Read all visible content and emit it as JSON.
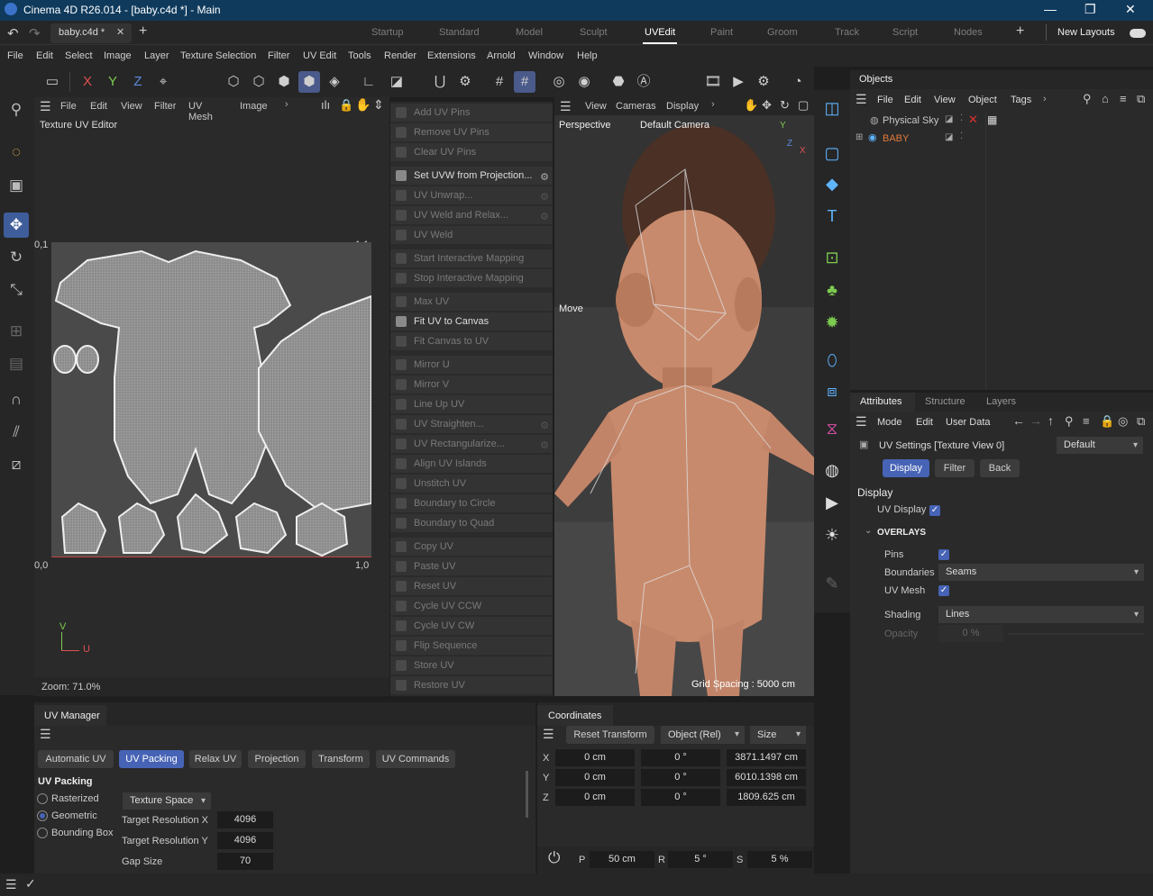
{
  "title": "Cinema 4D R26.014 - [baby.c4d *] - Main",
  "doc_tab": "baby.c4d *",
  "layouts": [
    {
      "label": "Startup",
      "active": false
    },
    {
      "label": "Standard",
      "active": false
    },
    {
      "label": "Model",
      "active": false
    },
    {
      "label": "Sculpt",
      "active": false
    },
    {
      "label": "UVEdit",
      "active": true
    },
    {
      "label": "Paint",
      "active": false
    },
    {
      "label": "Groom",
      "active": false
    },
    {
      "label": "Track",
      "active": false
    },
    {
      "label": "Script",
      "active": false
    },
    {
      "label": "Nodes",
      "active": false
    }
  ],
  "new_layouts": "New Layouts",
  "menu": [
    "File",
    "Edit",
    "Select",
    "Image",
    "Layer",
    "Texture Selection",
    "Filter",
    "UV Edit",
    "Tools",
    "Render",
    "Extensions",
    "Arnold",
    "Window",
    "Help"
  ],
  "uv_editor": {
    "submenu": [
      "File",
      "Edit",
      "View",
      "Filter",
      "UV Mesh",
      "Image"
    ],
    "title": "Texture UV Editor",
    "corners": {
      "tl": "0,1",
      "tr": "1,1",
      "bl": "0,0",
      "br": "1,0"
    },
    "axis_v": "V",
    "axis_u": "U",
    "zoom": "Zoom: 71.0%"
  },
  "commands": [
    {
      "label": "Add UV Pins",
      "enabled": false,
      "gear": false
    },
    {
      "label": "Remove UV Pins",
      "enabled": false,
      "gear": false
    },
    {
      "label": "Clear UV Pins",
      "enabled": false,
      "gear": false
    },
    {
      "label": "Set UVW from Projection...",
      "enabled": true,
      "gear": true
    },
    {
      "label": "UV Unwrap...",
      "enabled": false,
      "gear": true
    },
    {
      "label": "UV Weld and Relax...",
      "enabled": false,
      "gear": true
    },
    {
      "label": "UV Weld",
      "enabled": false,
      "gear": false
    },
    {
      "label": "Start Interactive Mapping",
      "enabled": false,
      "gear": false
    },
    {
      "label": "Stop Interactive Mapping",
      "enabled": false,
      "gear": false
    },
    {
      "label": "Max UV",
      "enabled": false,
      "gear": false
    },
    {
      "label": "Fit UV to Canvas",
      "enabled": true,
      "gear": false
    },
    {
      "label": "Fit Canvas to UV",
      "enabled": false,
      "gear": false
    },
    {
      "label": "Mirror U",
      "enabled": false,
      "gear": false
    },
    {
      "label": "Mirror V",
      "enabled": false,
      "gear": false
    },
    {
      "label": "Line Up UV",
      "enabled": false,
      "gear": false
    },
    {
      "label": "UV Straighten...",
      "enabled": false,
      "gear": true
    },
    {
      "label": "UV Rectangularize...",
      "enabled": false,
      "gear": true
    },
    {
      "label": "Align UV Islands",
      "enabled": false,
      "gear": false
    },
    {
      "label": "Unstitch UV",
      "enabled": false,
      "gear": false
    },
    {
      "label": "Boundary to Circle",
      "enabled": false,
      "gear": false
    },
    {
      "label": "Boundary to Quad",
      "enabled": false,
      "gear": false
    },
    {
      "label": "Copy UV",
      "enabled": false,
      "gear": false
    },
    {
      "label": "Paste UV",
      "enabled": false,
      "gear": false
    },
    {
      "label": "Reset UV",
      "enabled": false,
      "gear": false
    },
    {
      "label": "Cycle UV CCW",
      "enabled": false,
      "gear": false
    },
    {
      "label": "Cycle UV CW",
      "enabled": false,
      "gear": false
    },
    {
      "label": "Flip Sequence",
      "enabled": false,
      "gear": false
    },
    {
      "label": "Store UV",
      "enabled": false,
      "gear": false
    },
    {
      "label": "Restore UV",
      "enabled": false,
      "gear": false
    }
  ],
  "viewport": {
    "menu": [
      "View",
      "Cameras",
      "Display"
    ],
    "label": "Perspective",
    "camera": "Default Camera",
    "move": "Move",
    "grid": "Grid Spacing : 5000 cm",
    "axis_y": "Y",
    "axis_z": "Z",
    "axis_x": "X"
  },
  "objects": {
    "tab": "Objects",
    "menu": [
      "File",
      "Edit",
      "View",
      "Object",
      "Tags"
    ],
    "items": [
      {
        "name": "Physical Sky",
        "color": "#d0d0d0"
      },
      {
        "name": "BABY",
        "color": "#e07a3a"
      }
    ]
  },
  "attributes": {
    "tabs": [
      "Attributes",
      "Structure",
      "Layers"
    ],
    "menu": [
      "Mode",
      "Edit",
      "User Data"
    ],
    "header": "UV Settings [Texture View 0]",
    "preset": "Default",
    "buttons": [
      "Display",
      "Filter",
      "Back"
    ],
    "section": "Display",
    "uv_display": "UV Display",
    "overlays": "OVERLAYS",
    "pins": "Pins",
    "boundaries": "Boundaries",
    "boundaries_val": "Seams",
    "uv_mesh": "UV Mesh",
    "shading": "Shading",
    "shading_val": "Lines",
    "opacity": "Opacity",
    "opacity_val": "0 %"
  },
  "uv_manager": {
    "tab": "UV Manager",
    "tabs": [
      "Automatic UV",
      "UV Packing",
      "Relax UV",
      "Projection",
      "Transform",
      "UV Commands"
    ],
    "active_tab": "UV Packing",
    "section": "UV Packing",
    "radios": [
      {
        "label": "Rasterized",
        "checked": false
      },
      {
        "label": "Geometric",
        "checked": true
      },
      {
        "label": "Bounding Box",
        "checked": false
      }
    ],
    "space": "Texture Space",
    "res_x_label": "Target Resolution X",
    "res_x": "4096",
    "res_y_label": "Target Resolution Y",
    "res_y": "4096",
    "gap_label": "Gap Size",
    "gap": "70"
  },
  "coordinates": {
    "tab": "Coordinates",
    "reset": "Reset Transform",
    "mode": "Object (Rel)",
    "size": "Size",
    "rows": [
      {
        "axis": "X",
        "pos": "0 cm",
        "rot": "0 °",
        "size": "3871.1497 cm"
      },
      {
        "axis": "Y",
        "pos": "0 cm",
        "rot": "0 °",
        "size": "6010.1398 cm"
      },
      {
        "axis": "Z",
        "pos": "0 cm",
        "rot": "0 °",
        "size": "1809.625 cm"
      }
    ],
    "p_label": "P",
    "p": "50 cm",
    "r_label": "R",
    "r": "5 °",
    "s_label": "S",
    "s": "5 %"
  }
}
